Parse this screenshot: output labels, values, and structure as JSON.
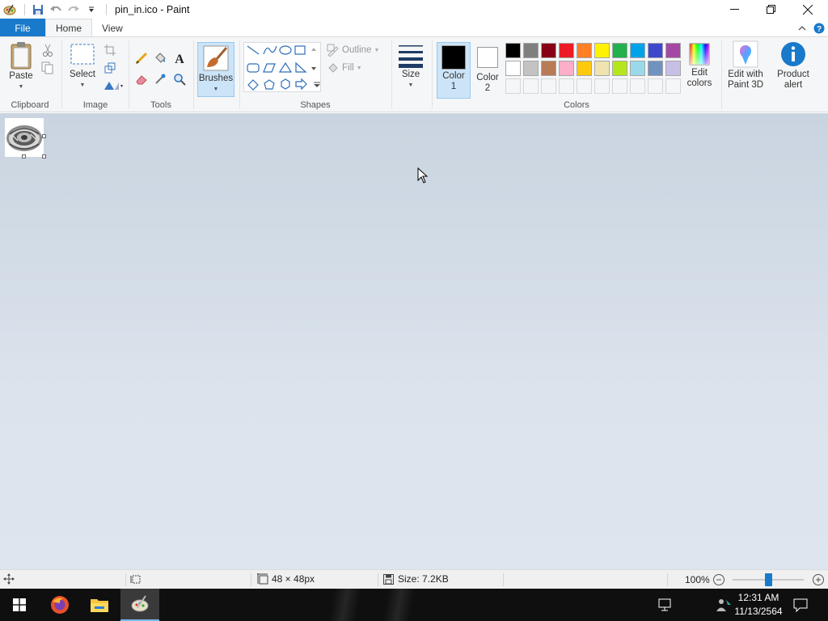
{
  "window": {
    "title": "pin_in.ico - Paint"
  },
  "tabs": {
    "file": "File",
    "home": "Home",
    "view": "View"
  },
  "clipboard": {
    "paste": "Paste",
    "group_label": "Clipboard"
  },
  "image": {
    "select": "Select",
    "group_label": "Image"
  },
  "tools": {
    "group_label": "Tools"
  },
  "brushes": {
    "label": "Brushes"
  },
  "shapes": {
    "outline": "Outline",
    "fill": "Fill",
    "group_label": "Shapes"
  },
  "size": {
    "label": "Size"
  },
  "colors": {
    "color1_line1": "Color",
    "color1_line2": "1",
    "color2_line1": "Color",
    "color2_line2": "2",
    "group_label": "Colors",
    "edit_line1": "Edit",
    "edit_line2": "colors",
    "color1_value": "#000000",
    "color2_value": "#ffffff",
    "palette_row1": [
      "#000000",
      "#7f7f7f",
      "#880015",
      "#ed1c24",
      "#ff7f27",
      "#fff200",
      "#22b14c",
      "#00a2e8",
      "#3f48cc",
      "#a349a4"
    ],
    "palette_row2": [
      "#ffffff",
      "#c3c3c3",
      "#b97a57",
      "#ffaec9",
      "#ffc90e",
      "#efe4b0",
      "#b5e61d",
      "#99d9ea",
      "#7092be",
      "#c8bfe7"
    ]
  },
  "paint3d": {
    "line1": "Edit with",
    "line2": "Paint 3D"
  },
  "product_alert": {
    "line1": "Product",
    "line2": "alert"
  },
  "status": {
    "dimensions": "48 × 48px",
    "size": "Size: 7.2KB",
    "zoom": "100%",
    "zoom_level": 1.0
  },
  "taskbar": {
    "time": "12:31 AM",
    "date": "11/13/2564"
  }
}
